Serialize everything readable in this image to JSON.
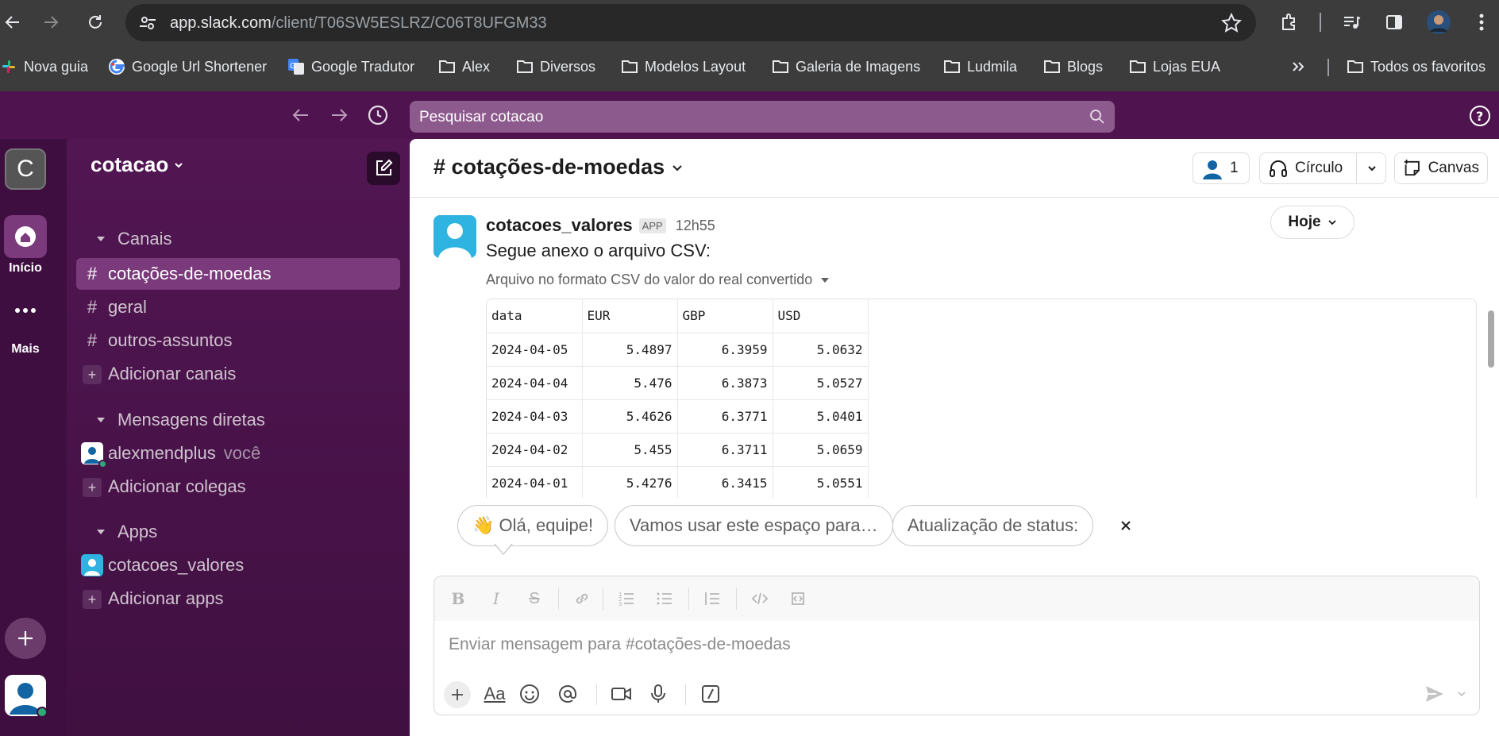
{
  "browser": {
    "url_host": "app.slack.com",
    "url_path": "/client/T06SW5ESLRZ/C06T8UFGM33",
    "bookmarks": [
      {
        "label": "Nova guia",
        "icon": "slack-icon"
      },
      {
        "label": "Google Url Shortener",
        "icon": "google-icon"
      },
      {
        "label": "Google Tradutor",
        "icon": "translate-icon"
      },
      {
        "label": "Alex",
        "icon": "folder-icon"
      },
      {
        "label": "Diversos",
        "icon": "folder-icon"
      },
      {
        "label": "Modelos Layout",
        "icon": "folder-icon"
      },
      {
        "label": "Galeria de Imagens",
        "icon": "folder-icon"
      },
      {
        "label": "Ludmila",
        "icon": "folder-icon"
      },
      {
        "label": "Blogs",
        "icon": "folder-icon"
      },
      {
        "label": "Lojas EUA",
        "icon": "folder-icon"
      }
    ],
    "all_bookmarks_label": "Todos os favoritos"
  },
  "slack": {
    "search_placeholder": "Pesquisar cotacao",
    "rail": {
      "workspace_initial": "C",
      "home_label": "Início",
      "more_label": "Mais"
    },
    "sidebar": {
      "workspace_name": "cotacao",
      "channels_header": "Canais",
      "channels": [
        "cotações-de-moedas",
        "geral",
        "outros-assuntos"
      ],
      "add_channels": "Adicionar canais",
      "dm_header": "Mensagens diretas",
      "dm_user": "alexmendplus",
      "dm_you": "você",
      "add_colleagues": "Adicionar colegas",
      "apps_header": "Apps",
      "app_name": "cotacoes_valores",
      "add_apps": "Adicionar apps"
    },
    "channel": {
      "name": "# cotações-de-moedas",
      "member_count": "1",
      "huddle_label": "Círculo",
      "canvas_label": "Canvas",
      "date_divider": "Hoje"
    },
    "message": {
      "author": "cotacoes_valores",
      "badge": "APP",
      "time": "12h55",
      "text": "Segue anexo o arquivo CSV:",
      "file_title": "Arquivo no formato CSV do valor do real convertido",
      "csv_header": [
        "data",
        "EUR",
        "GBP",
        "USD"
      ],
      "csv_rows": [
        [
          "2024-04-05",
          "5.4897",
          "6.3959",
          "5.0632"
        ],
        [
          "2024-04-04",
          "5.476",
          "6.3873",
          "5.0527"
        ],
        [
          "2024-04-03",
          "5.4626",
          "6.3771",
          "5.0401"
        ],
        [
          "2024-04-02",
          "5.455",
          "6.3711",
          "5.0659"
        ],
        [
          "2024-04-01",
          "5.4276",
          "6.3415",
          "5.0551"
        ]
      ]
    },
    "suggestions": [
      "👋 Olá, equipe!",
      "Vamos usar este espaço para…",
      "Atualização de status:"
    ],
    "composer_placeholder": "Enviar mensagem para #cotações-de-moedas",
    "colors": {
      "aubergine": "#4a154b",
      "rail": "#3f0e40",
      "active_item": "#7a3a7b",
      "online": "#2bac76"
    }
  }
}
